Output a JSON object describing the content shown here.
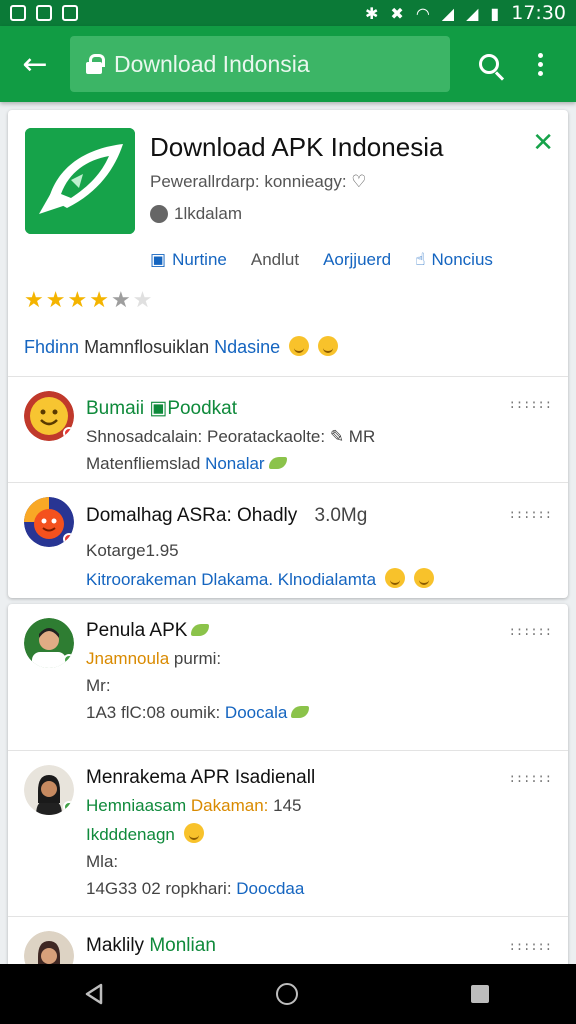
{
  "status_bar": {
    "time": "17:30"
  },
  "toolbar": {
    "url_text": "Download Indonsia"
  },
  "app": {
    "title": "Download APK Indonesia",
    "subtitle": "Pewerallrdarp: konnieagy: ♡",
    "meta": "1lkdalam",
    "actions": [
      {
        "label": "Nurtine"
      },
      {
        "label": "Andlut"
      },
      {
        "label": "Aorjjuerd"
      },
      {
        "label": "Noncius"
      }
    ],
    "rating": 3.5,
    "tagline_part1": "Fhdinn",
    "tagline_part2": "Mamnflosuiklan",
    "tagline_part3": "Ndasine"
  },
  "reviews": [
    {
      "name": "Bumaii",
      "name_tag": "Poodkat",
      "line1": "Shnosadcalain: Peoratackaolte: ✎ MR",
      "line2_a": "Matenfliemslad",
      "line2_b": "Nonalar",
      "menu": "::::::"
    },
    {
      "name": "Domalhag ASRa: Ohadly",
      "name_extra": "3.0Mg",
      "line1": "Kotarge1.95",
      "line2": "Kitroorakeman Dlakama. Klnodialamta",
      "menu": "::::::"
    },
    {
      "name": "Penula APK",
      "line1_a": "Jnamnoula",
      "line1_b": "purmi:",
      "line2": "Mr:",
      "line3_a": "1A3 flC:08 oumik:",
      "line3_b": "Doocala",
      "menu": "::::::"
    },
    {
      "name": "Menrakema APR Isadienall",
      "line1_a": "Hemniaasam",
      "line1_b": "Dakaman:",
      "line1_c": "145",
      "line2": "Ikdddenagn",
      "line3": "Mla:",
      "line4_a": "14G33 02 ropkhari:",
      "line4_b": "Doocdaa",
      "menu": "::::::"
    },
    {
      "name": "Maklily",
      "name_tag": "Monlian",
      "menu": "::::::"
    }
  ]
}
